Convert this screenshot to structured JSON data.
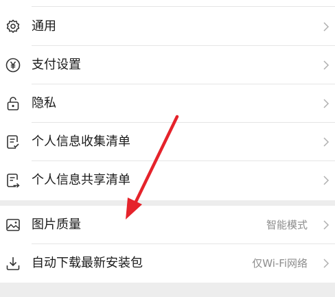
{
  "settings": {
    "items": [
      {
        "label": "通用",
        "icon": "gear-icon"
      },
      {
        "label": "支付设置",
        "icon": "yuan-icon"
      },
      {
        "label": "隐私",
        "icon": "lock-icon"
      },
      {
        "label": "个人信息收集清单",
        "icon": "checklist-icon"
      },
      {
        "label": "个人信息共享清单",
        "icon": "shared-list-icon"
      },
      {
        "label": "图片质量",
        "value": "智能模式",
        "icon": "image-icon"
      },
      {
        "label": "自动下载最新安装包",
        "value": "仅Wi-Fi网络",
        "icon": "download-icon"
      }
    ]
  },
  "colors": {
    "arrow": "#e5232b",
    "background": "#ededed",
    "row": "#ffffff",
    "text": "#1a1a1a",
    "secondary_text": "#8c8c8c",
    "icon": "#333333"
  }
}
